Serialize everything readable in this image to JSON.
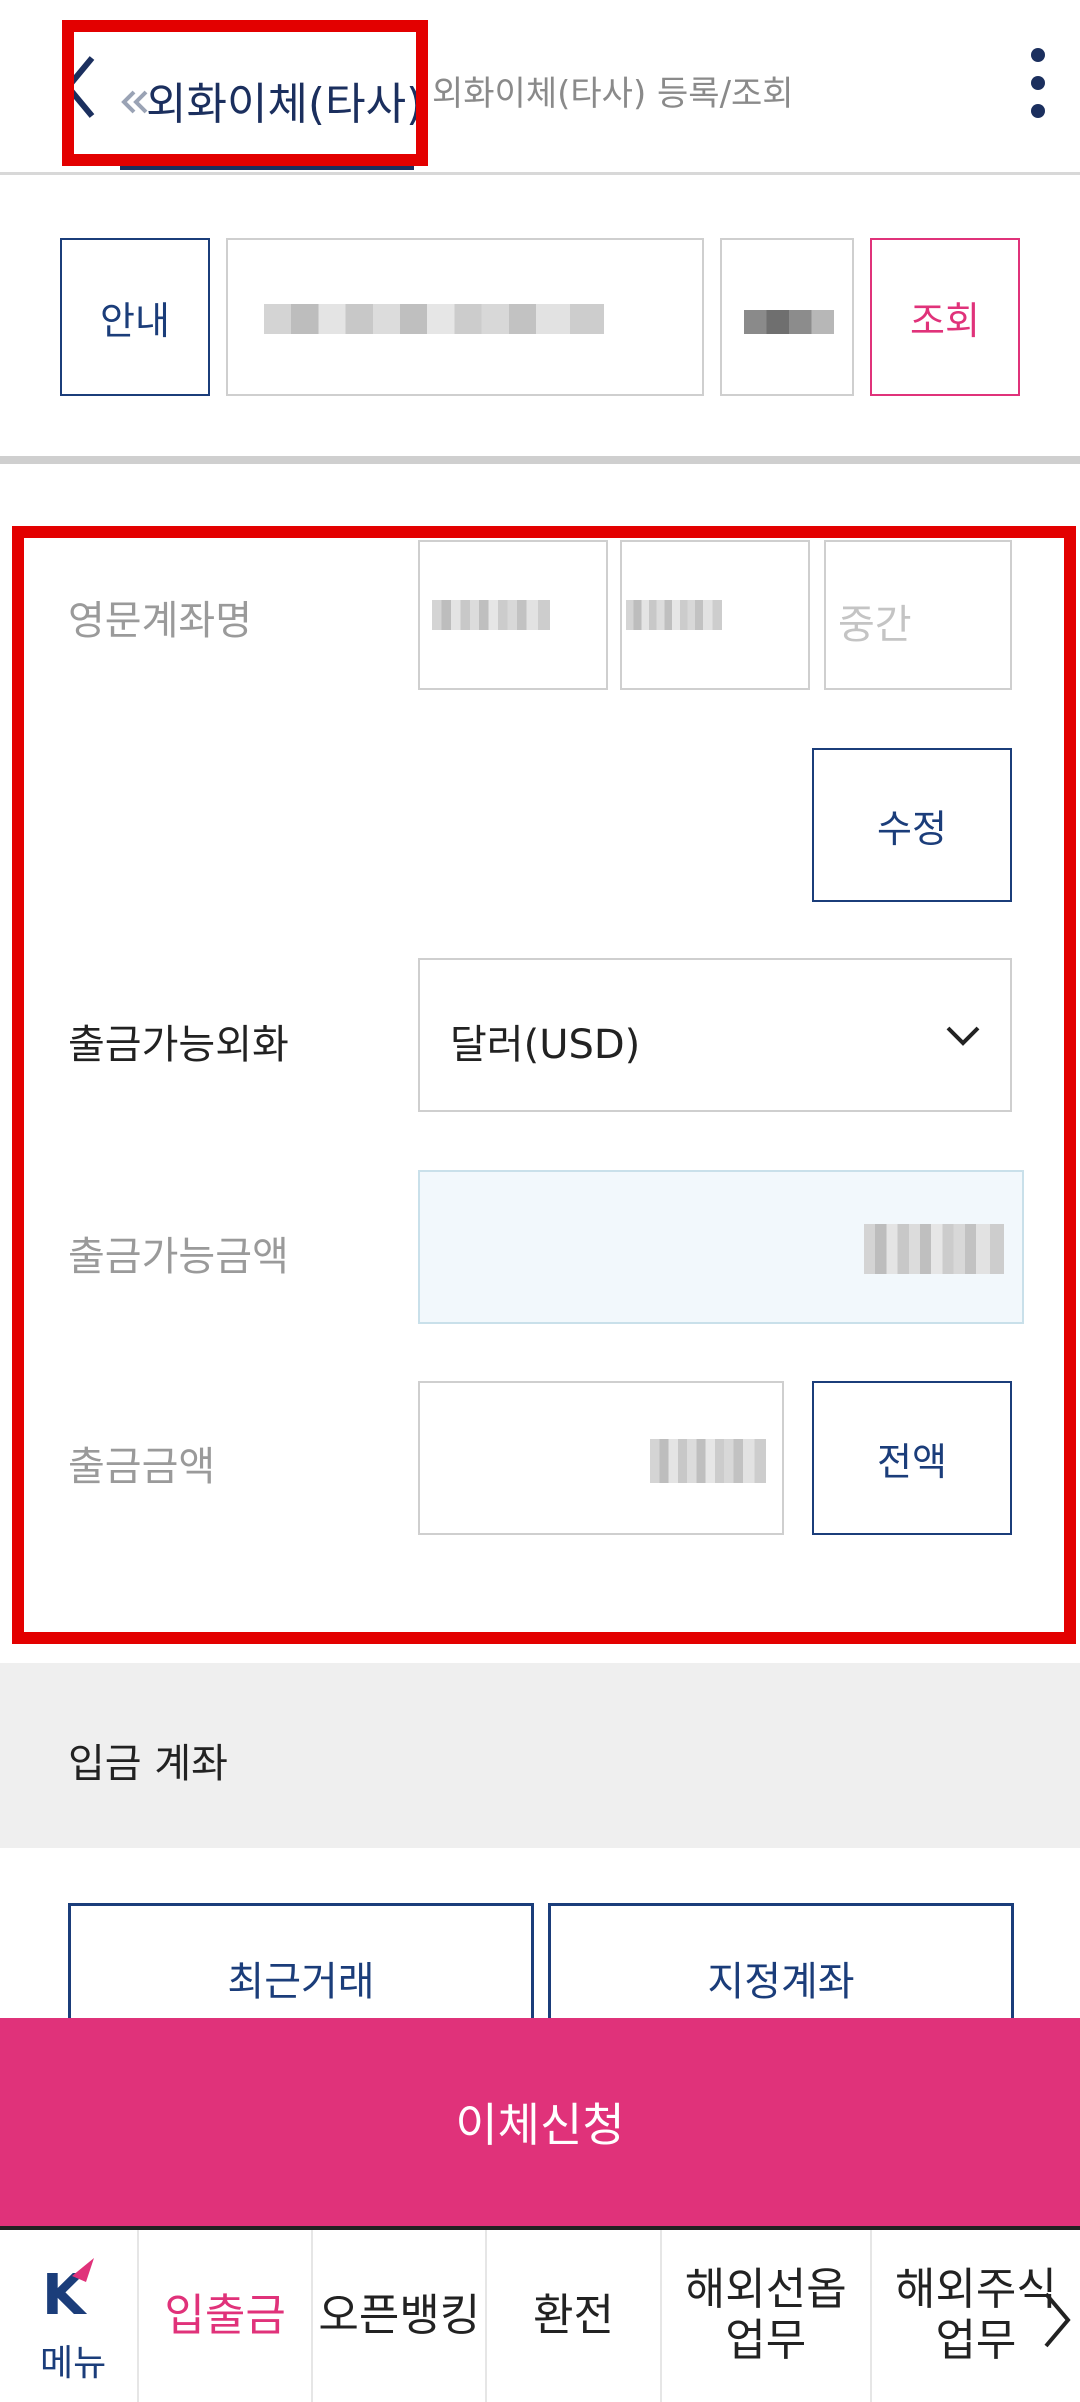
{
  "header": {
    "back_icon": "chevron-left-icon",
    "active_tab": "외화이체(타사)",
    "inactive_tab": "외화이체(타사) 등록/조회",
    "more_icon": "vertical-dots-icon",
    "accent_color": "#1b2f5e"
  },
  "account_row": {
    "guide_label": "안내",
    "query_label": "조회"
  },
  "form": {
    "english_name_label": "영문계좌명",
    "middle_name_placeholder": "중간",
    "edit_label": "수정",
    "currency_label": "출금가능외화",
    "currency_value": "달러(USD)",
    "available_amount_label": "출금가능금액",
    "withdraw_amount_label": "출금금액",
    "all_amount_label": "전액"
  },
  "deposit": {
    "title": "입금 계좌",
    "recent_label": "최근거래",
    "designated_label": "지정계좌"
  },
  "primary_action": {
    "label": "이체신청",
    "color": "#e0327a"
  },
  "bottom_nav": {
    "menu_label": "메뉴",
    "items": [
      {
        "label": "입출금",
        "active": true
      },
      {
        "label": "오픈뱅킹",
        "active": false
      },
      {
        "label": "환전",
        "active": false
      },
      {
        "label": "해외선옵 업무",
        "active": false
      },
      {
        "label": "해외주식 업무",
        "active": false
      }
    ]
  }
}
